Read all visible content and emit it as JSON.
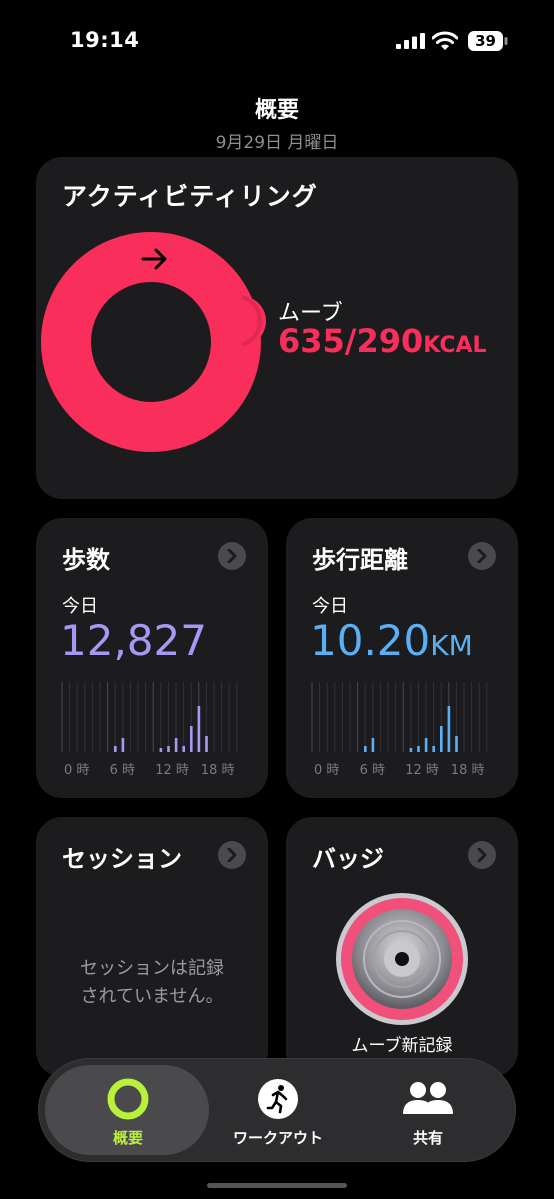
{
  "status_bar": {
    "time": "19:14",
    "battery": "39"
  },
  "header": {
    "title": "概要",
    "date": "9月29日 月曜日"
  },
  "activity_rings": {
    "title": "アクティビティリング",
    "move_label": "ムーブ",
    "move_value": "635/290",
    "move_unit": "KCAL",
    "move_progress_percent": 219,
    "color": "#fa2e5b"
  },
  "steps": {
    "title": "歩数",
    "today_label": "今日",
    "value": "12,827",
    "color": "#a897f5",
    "axis_labels": [
      "0 時",
      "6 時",
      "12 時",
      "18 時"
    ]
  },
  "distance": {
    "title": "歩行距離",
    "today_label": "今日",
    "value": "10.20",
    "unit": "KM",
    "color": "#5ab0f7",
    "axis_labels": [
      "0 時",
      "6 時",
      "12 時",
      "18 時"
    ]
  },
  "sessions": {
    "title": "セッション",
    "empty_line1": "セッションは記録",
    "empty_line2": "されていません。"
  },
  "badges": {
    "title": "バッジ",
    "caption": "ムーブ新記録"
  },
  "tabbar": {
    "tabs": [
      {
        "label": "概要",
        "icon": "activity-ring-icon",
        "selected": true
      },
      {
        "label": "ワークアウト",
        "icon": "runner-icon",
        "selected": false
      },
      {
        "label": "共有",
        "icon": "people-icon",
        "selected": false
      }
    ],
    "accent": "#b9f13a"
  }
}
